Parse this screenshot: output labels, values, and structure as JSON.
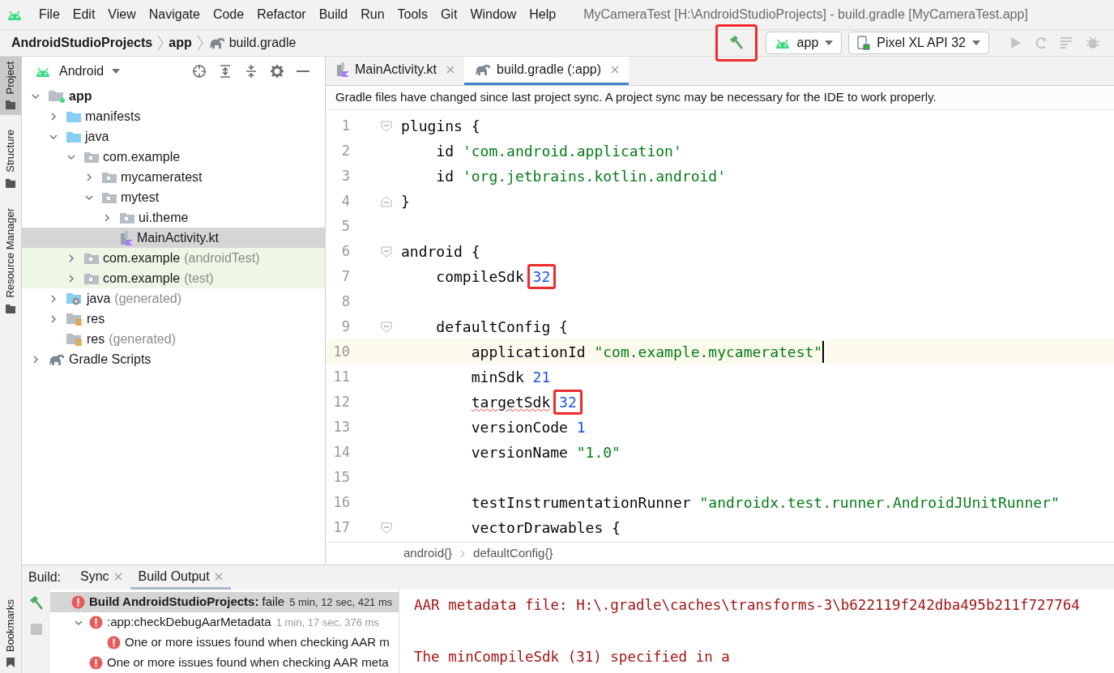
{
  "menu_bar": {
    "items": [
      {
        "label": "File"
      },
      {
        "label": "Edit"
      },
      {
        "label": "View"
      },
      {
        "label": "Navigate"
      },
      {
        "label": "Code"
      },
      {
        "label": "Refactor"
      },
      {
        "label": "Build"
      },
      {
        "label": "Run"
      },
      {
        "label": "Tools"
      },
      {
        "label": "Git"
      },
      {
        "label": "Window"
      },
      {
        "label": "Help"
      }
    ],
    "title": "MyCameraTest [H:\\AndroidStudioProjects] - build.gradle [MyCameraTest.app]"
  },
  "breadcrumbs": [
    {
      "label": "AndroidStudioProjects",
      "bold": true,
      "kind": "folder"
    },
    {
      "label": "app",
      "bold": true,
      "kind": "folder"
    },
    {
      "label": "build.gradle",
      "bold": false,
      "kind": "gradle"
    }
  ],
  "toolbar": {
    "build_button": {
      "highlighted": true
    },
    "run_config": "app",
    "device": "Pixel XL API 32"
  },
  "tool_stripe": {
    "top": [
      {
        "label": "Project",
        "selected": true
      },
      {
        "label": "Structure",
        "selected": false
      },
      {
        "label": "Resource Manager",
        "selected": false
      }
    ],
    "bottom": [
      {
        "label": "Bookmarks",
        "selected": false
      }
    ]
  },
  "project_panel": {
    "view": "Android",
    "tree": [
      {
        "label": "app",
        "kind": "module",
        "expanded": true,
        "bold": true,
        "selected": false,
        "test": false,
        "children": [
          {
            "label": "manifests",
            "kind": "folder",
            "expanded": false,
            "bold": false,
            "selected": false,
            "test": false
          },
          {
            "label": "java",
            "kind": "folder",
            "expanded": true,
            "bold": false,
            "selected": false,
            "test": false,
            "children": [
              {
                "label": "com.example",
                "kind": "package",
                "expanded": true,
                "bold": false,
                "selected": false,
                "test": false,
                "children": [
                  {
                    "label": "mycameratest",
                    "kind": "package",
                    "expanded": false,
                    "bold": false,
                    "selected": false,
                    "test": false
                  },
                  {
                    "label": "mytest",
                    "kind": "package",
                    "expanded": true,
                    "bold": false,
                    "selected": false,
                    "test": false,
                    "children": [
                      {
                        "label": "ui.theme",
                        "kind": "package",
                        "expanded": false,
                        "bold": false,
                        "selected": false,
                        "test": false
                      },
                      {
                        "label": "MainActivity.kt",
                        "kind": "kotlin",
                        "bold": false,
                        "selected": true,
                        "test": false
                      }
                    ]
                  }
                ]
              },
              {
                "label": "com.example",
                "suffix": "(androidTest)",
                "kind": "package",
                "expanded": false,
                "bold": false,
                "selected": false,
                "test": true
              },
              {
                "label": "com.example",
                "suffix": "(test)",
                "kind": "package",
                "expanded": false,
                "bold": false,
                "selected": false,
                "test": true
              }
            ]
          },
          {
            "label": "java",
            "suffix": "(generated)",
            "kind": "generated",
            "expanded": false,
            "bold": false,
            "selected": false,
            "test": false
          },
          {
            "label": "res",
            "kind": "res",
            "expanded": false,
            "bold": false,
            "selected": false,
            "test": false
          },
          {
            "label": "res",
            "suffix": "(generated)",
            "kind": "res",
            "bold": false,
            "selected": false,
            "test": false
          }
        ]
      },
      {
        "label": "Gradle Scripts",
        "kind": "gradle",
        "expanded": false,
        "bold": false,
        "selected": false,
        "test": false
      }
    ]
  },
  "editor": {
    "tabs": [
      {
        "label": "MainActivity.kt",
        "kind": "kotlin",
        "selected": false
      },
      {
        "label": "build.gradle (:app)",
        "kind": "gradle",
        "selected": true
      }
    ],
    "notice": "Gradle files have changed since last project sync. A project sync may be necessary for the IDE to work properly.",
    "lines": [
      {
        "number": "1",
        "kind": "fold_start",
        "current": false,
        "tokens": [
          {
            "text": "plugins {",
            "kind": "plain"
          }
        ]
      },
      {
        "number": "2",
        "kind": "plain",
        "current": false,
        "tokens": [
          {
            "text": "    id ",
            "kind": "plain"
          },
          {
            "text": "'com.android.application'",
            "kind": "string"
          }
        ]
      },
      {
        "number": "3",
        "kind": "plain",
        "current": false,
        "tokens": [
          {
            "text": "    id ",
            "kind": "plain"
          },
          {
            "text": "'org.jetbrains.kotlin.android'",
            "kind": "string"
          }
        ]
      },
      {
        "number": "4",
        "kind": "fold_end",
        "current": false,
        "tokens": [
          {
            "text": "}",
            "kind": "plain"
          }
        ]
      },
      {
        "number": "5",
        "kind": "plain",
        "current": false
      },
      {
        "number": "6",
        "kind": "fold_start",
        "current": false,
        "tokens": [
          {
            "text": "android {",
            "kind": "plain"
          }
        ]
      },
      {
        "number": "7",
        "kind": "plain",
        "current": false,
        "tokens": [
          {
            "text": "    compileSdk ",
            "kind": "plain"
          },
          {
            "text": "32",
            "kind": "number",
            "highlighted": true
          }
        ]
      },
      {
        "number": "8",
        "kind": "plain",
        "current": false
      },
      {
        "number": "9",
        "kind": "fold_start",
        "current": false,
        "tokens": [
          {
            "text": "    defaultConfig {",
            "kind": "plain"
          }
        ]
      },
      {
        "number": "10",
        "kind": "plain",
        "current": true,
        "caret": true,
        "tokens": [
          {
            "text": "        applicationId ",
            "kind": "plain"
          },
          {
            "text": "\"com.example.mycameratest\"",
            "kind": "string"
          }
        ]
      },
      {
        "number": "11",
        "kind": "plain",
        "current": false,
        "tokens": [
          {
            "text": "        minSdk ",
            "kind": "plain"
          },
          {
            "text": "21",
            "kind": "number"
          }
        ]
      },
      {
        "number": "12",
        "kind": "plain",
        "current": false,
        "tokens": [
          {
            "text": "        targetSdk",
            "kind": "plain",
            "warning": true
          },
          {
            "text": " 32",
            "kind": "number",
            "highlighted": true
          }
        ]
      },
      {
        "number": "13",
        "kind": "plain",
        "current": false,
        "tokens": [
          {
            "text": "        versionCode ",
            "kind": "plain"
          },
          {
            "text": "1",
            "kind": "number"
          }
        ]
      },
      {
        "number": "14",
        "kind": "plain",
        "current": false,
        "tokens": [
          {
            "text": "        versionName ",
            "kind": "plain"
          },
          {
            "text": "\"1.0\"",
            "kind": "string"
          }
        ]
      },
      {
        "number": "15",
        "kind": "plain",
        "current": false
      },
      {
        "number": "16",
        "kind": "plain",
        "current": false,
        "tokens": [
          {
            "text": "        testInstrumentationRunner ",
            "kind": "plain"
          },
          {
            "text": "\"androidx.test.runner.AndroidJUnitRunner\"",
            "kind": "string"
          }
        ]
      },
      {
        "number": "17",
        "kind": "fold_start",
        "current": false,
        "tokens": [
          {
            "text": "        vectorDrawables {",
            "kind": "plain"
          }
        ]
      }
    ],
    "breadcrumbs": [
      "android{}",
      "defaultConfig{}"
    ]
  },
  "build_panel": {
    "label": "Build:",
    "tabs": [
      {
        "label": "Sync",
        "selected": false
      },
      {
        "label": "Build Output",
        "selected": true
      }
    ],
    "tree": [
      {
        "text": "**Build AndroidStudioProjects:** faile",
        "time": "5 min, 12 sec, 421 ms",
        "selected": true,
        "children": [
          {
            "text": ":app:checkDebugAarMetadata",
            "time": "1 min, 17 sec, 376 ms",
            "expanded": true,
            "selected": false,
            "children": [
              {
                "text": "One or more issues found when checking AAR m",
                "selected": false
              }
            ]
          },
          {
            "text": "One or more issues found when checking AAR meta",
            "selected": false
          }
        ]
      }
    ],
    "console": [
      "AAR metadata file: H:\\.gradle\\caches\\transforms-3\\b622119f242dba495b211f727764",
      "The minCompileSdk (31) specified in a"
    ]
  }
}
